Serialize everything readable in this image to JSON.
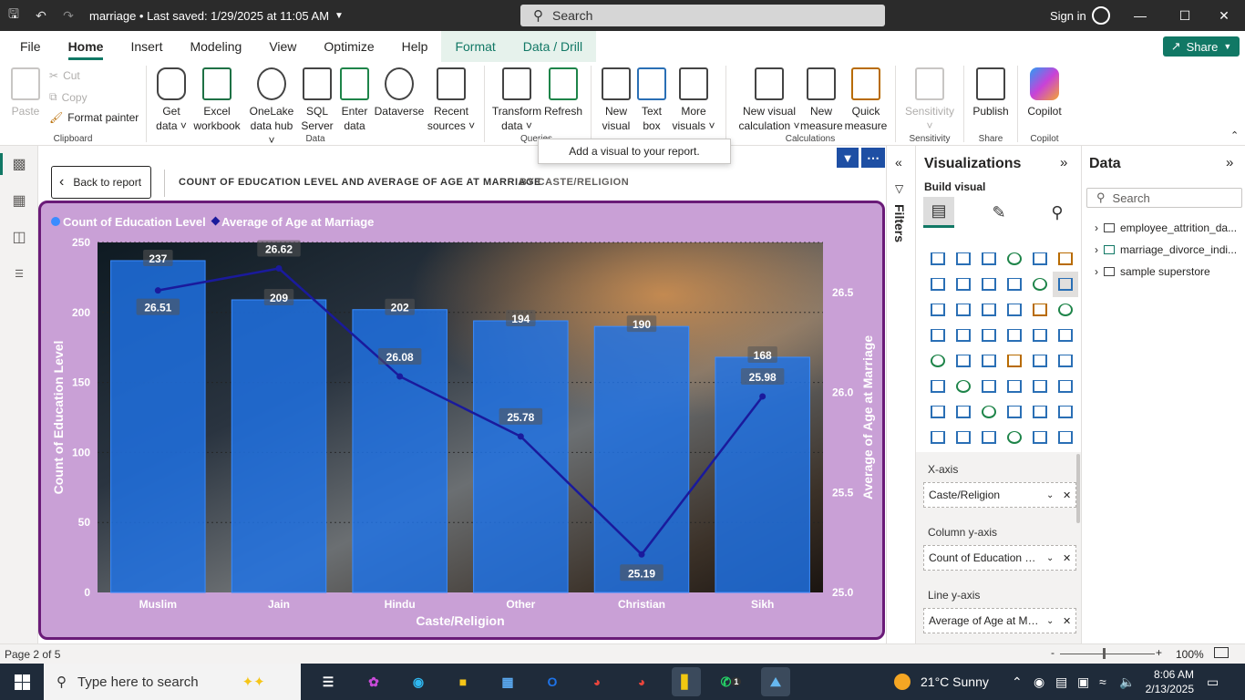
{
  "titlebar": {
    "doc_title": "marriage • Last saved: 1/29/2025 at 11:05 AM",
    "search_placeholder": "Search",
    "sign_in": "Sign in"
  },
  "menu": {
    "tabs": [
      "File",
      "Home",
      "Insert",
      "Modeling",
      "View",
      "Optimize",
      "Help",
      "Format",
      "Data / Drill"
    ],
    "active": "Home",
    "share": "Share"
  },
  "ribbon": {
    "clipboard": {
      "paste": "Paste",
      "cut": "Cut",
      "copy": "Copy",
      "format_painter": "Format painter",
      "label": "Clipboard"
    },
    "data": {
      "get_data": [
        "Get",
        "data ˅"
      ],
      "excel": [
        "Excel",
        "workbook"
      ],
      "onelake": [
        "OneLake",
        "data hub ˅"
      ],
      "sql": [
        "SQL",
        "Server"
      ],
      "enter": [
        "Enter",
        "data"
      ],
      "dataverse": [
        "Dataverse",
        ""
      ],
      "recent": [
        "Recent",
        "sources ˅"
      ],
      "label": "Data"
    },
    "queries": {
      "transform": [
        "Transform",
        "data ˅"
      ],
      "refresh": [
        "Refresh",
        ""
      ],
      "label": "Queries"
    },
    "insert": {
      "new_visual": [
        "New",
        "visual"
      ],
      "text_box": [
        "Text",
        "box"
      ],
      "more_visuals": [
        "More",
        "visuals ˅"
      ]
    },
    "calculations": {
      "new_visual_calc": [
        "New visual",
        "calculation ˅"
      ],
      "new_measure": [
        "New",
        "measure"
      ],
      "quick_measure": [
        "Quick",
        "measure"
      ],
      "label": "Calculations"
    },
    "sensitivity": {
      "btn": [
        "Sensitivity",
        "˅"
      ],
      "label": "Sensitivity"
    },
    "share": {
      "publish": [
        "Publish",
        ""
      ],
      "label": "Share"
    },
    "copilot": {
      "btn": [
        "Copilot",
        ""
      ],
      "label": "Copilot"
    }
  },
  "canvas": {
    "tooltip": "Add a visual to your report.",
    "back": "Back to report",
    "header_title": "COUNT OF EDUCATION LEVEL AND AVERAGE OF AGE AT MARRIAGE",
    "header_sub": "BY CASTE/RELIGION"
  },
  "colors": {
    "accent": "#117865",
    "bar": "#1e73e8",
    "line": "#1a1a9c",
    "visual_bg": "#c9a0d6",
    "visual_border": "#6a1b78"
  },
  "chart_data": {
    "type": "bar",
    "categories": [
      "Muslim",
      "Jain",
      "Hindu",
      "Other",
      "Christian",
      "Sikh"
    ],
    "series": [
      {
        "name": "Count of Education Level",
        "type": "bar",
        "axis": "left",
        "values": [
          237,
          209,
          202,
          194,
          190,
          168
        ]
      },
      {
        "name": "Average of Age at Marriage",
        "type": "line",
        "axis": "right",
        "values": [
          26.51,
          26.62,
          26.08,
          25.78,
          25.19,
          25.98
        ]
      }
    ],
    "xlabel": "Caste/Religion",
    "ylabel": "Count of Education Level",
    "y2label": "Average of Age at Marriage",
    "ylim": [
      0,
      250
    ],
    "y2lim": [
      25.0,
      26.75
    ],
    "yticks": [
      "0",
      "50",
      "100",
      "150",
      "200",
      "250"
    ],
    "y2ticks": [
      "25.0",
      "25.5",
      "26.0",
      "26.5"
    ],
    "legend": "top-left",
    "grid": true
  },
  "filters": {
    "label": "Filters"
  },
  "visualizations": {
    "title": "Visualizations",
    "build": "Build visual",
    "wells": [
      {
        "title": "X-axis",
        "field": "Caste/Religion"
      },
      {
        "title": "Column y-axis",
        "field": "Count of Education Le..."
      },
      {
        "title": "Line y-axis",
        "field": "Average of Age at Ma..."
      }
    ]
  },
  "data_pane": {
    "title": "Data",
    "search": "Search",
    "items": [
      "employee_attrition_da...",
      "marriage_divorce_indi...",
      "sample superstore"
    ]
  },
  "status": {
    "page": "Page 2 of 5",
    "zoom": "100%"
  },
  "taskbar": {
    "search": "Type here to search",
    "weather": "21°C  Sunny",
    "time": "8:06 AM",
    "date": "2/13/2025",
    "badge": "1"
  }
}
